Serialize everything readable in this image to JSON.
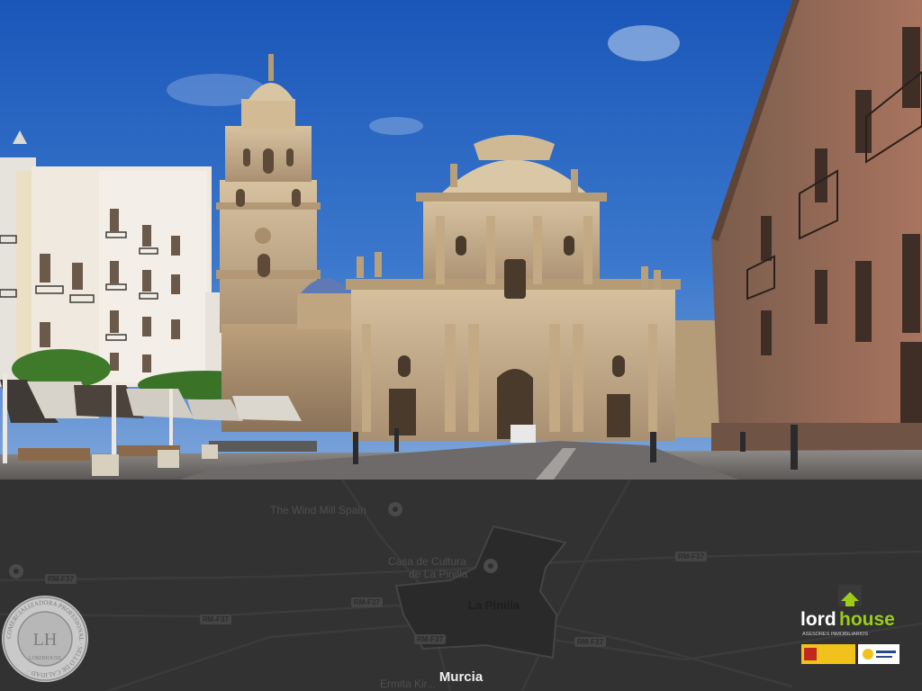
{
  "map": {
    "city_label": "Murcia",
    "area_label": "La Pinilla",
    "poi_windmill": "The Wind Mill Spain",
    "poi_casa_line1": "Casa de Cultura",
    "poi_casa_line2": "de La Pinilla",
    "poi_ermita": "Ermita Kir...",
    "road_shields": [
      "RM-F37",
      "RM-F37",
      "RM-F37",
      "RM-F37",
      "RM-F37",
      "RM-F37"
    ]
  },
  "seal": {
    "monogram": "LH",
    "ring_text": "COMERCIALIZADORA PROFESIONAL · SELLO DE CALIDAD ·",
    "bottom_text": "LORDHOUSE"
  },
  "logo": {
    "brand_prefix": "lord",
    "brand_suffix": "house",
    "tagline": "ASESORES INMOBILIARIOS"
  },
  "colors": {
    "sky_top": "#1a56b8",
    "sky_bottom": "#5b8fd6",
    "stone": "#c9b08a",
    "map_bg": "#323232",
    "logo_green": "#9ccc1a"
  }
}
